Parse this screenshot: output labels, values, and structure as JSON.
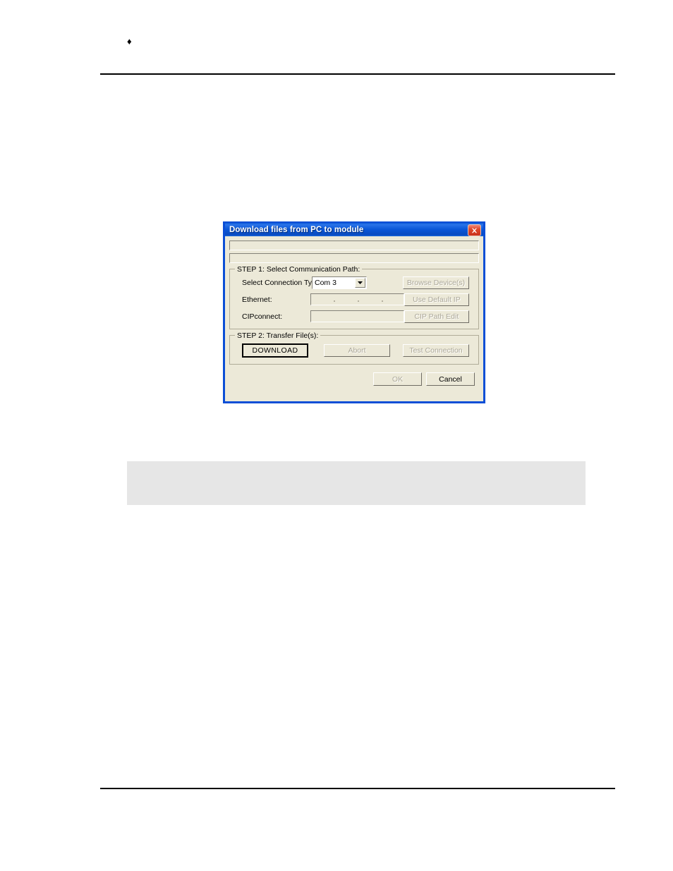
{
  "page": {
    "bullet": "♦"
  },
  "dialog": {
    "title": "Download files from PC to module",
    "close_label": "Close",
    "status_line_1": "",
    "status_line_2": "",
    "step1": {
      "title": "STEP 1: Select Communication Path:",
      "connection_type_label": "Select Connection Type:",
      "connection_type_value": "Com 3",
      "connection_type_options": [
        "Com 3"
      ],
      "browse_devices_label": "Browse Device(s)",
      "ethernet_label": "Ethernet:",
      "ethernet_value": "",
      "use_default_ip_label": "Use Default IP",
      "cipconnect_label": "CIPconnect:",
      "cipconnect_value": "",
      "cip_path_edit_label": "CIP Path Edit"
    },
    "step2": {
      "title": "STEP 2: Transfer File(s):",
      "download_label": "DOWNLOAD",
      "abort_label": "Abort",
      "test_connection_label": "Test Connection"
    },
    "footer": {
      "ok_label": "OK",
      "cancel_label": "Cancel"
    }
  },
  "colors": {
    "titlebar_blue": "#0b57d8",
    "dialog_face": "#ece9d8",
    "close_red": "#c8301a",
    "disabled_text": "#aca899",
    "note_box": "#e6e6e6"
  }
}
